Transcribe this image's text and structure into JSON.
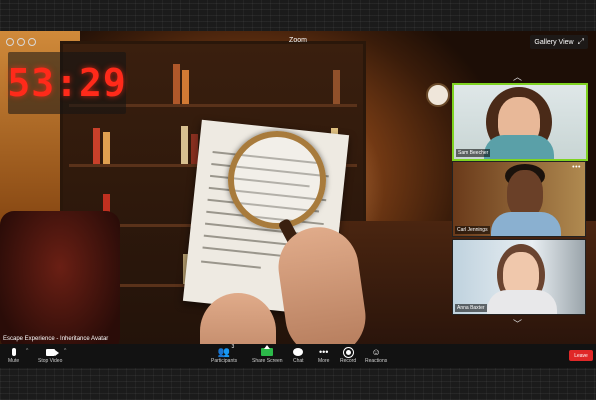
{
  "window": {
    "title": "Zoom",
    "view_button": "Gallery View"
  },
  "timer": {
    "value": "53:29"
  },
  "meeting": {
    "name": "Escape Experience - Inheritance Avatar"
  },
  "participants": [
    {
      "name": "Sam Beecher",
      "active": true
    },
    {
      "name": "Carl Jennings",
      "active": false
    },
    {
      "name": "Anna Baxter",
      "active": false
    }
  ],
  "toolbar": {
    "mute": "Mute",
    "stop_video": "Stop Video",
    "participants": "Participants",
    "participants_count": "3",
    "share_screen": "Share Screen",
    "chat": "Chat",
    "more": "More",
    "record": "Record",
    "reactions": "Reactions",
    "leave": "Leave"
  },
  "colors": {
    "active_speaker": "#7fd321",
    "timer": "#ff2a1a",
    "leave": "#e02828",
    "share": "#2cb94a"
  },
  "icons": [
    "mic-icon",
    "video-icon",
    "participants-icon",
    "share-screen-icon",
    "chat-icon",
    "more-icon",
    "record-icon",
    "reactions-icon",
    "expand-icon",
    "chevron-up-icon",
    "chevron-down-icon"
  ]
}
